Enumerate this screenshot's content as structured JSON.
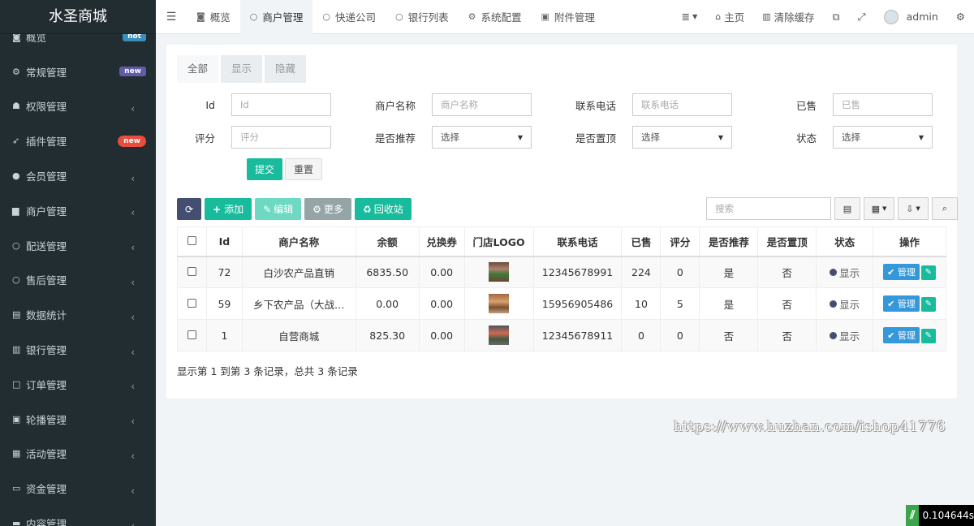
{
  "app_title": "水圣商城",
  "sidebar": {
    "items": [
      {
        "icon": "dashboard-icon",
        "glyph": "◙",
        "label": "概览",
        "badge": "hot",
        "badge_class": "hot"
      },
      {
        "icon": "cogs-icon",
        "glyph": "⚙",
        "label": "常规管理",
        "badge": "new",
        "badge_class": "new-purple"
      },
      {
        "icon": "group-icon",
        "glyph": "☗",
        "label": "权限管理",
        "chev": "‹"
      },
      {
        "icon": "rocket-icon",
        "glyph": "➶",
        "label": "插件管理",
        "badge": "new",
        "badge_class": "new-red"
      },
      {
        "icon": "user-circle-icon",
        "glyph": "●",
        "label": "会员管理",
        "chev": "‹"
      },
      {
        "icon": "shop-icon",
        "glyph": "▆",
        "label": "商户管理",
        "chev": "‹"
      },
      {
        "icon": "circle-outline-icon",
        "glyph": "○",
        "label": "配送管理",
        "chev": "‹"
      },
      {
        "icon": "circle-outline-icon",
        "glyph": "○",
        "label": "售后管理",
        "chev": "‹"
      },
      {
        "icon": "database-icon",
        "glyph": "▤",
        "label": "数据统计",
        "chev": "‹"
      },
      {
        "icon": "bank-icon",
        "glyph": "▥",
        "label": "银行管理",
        "chev": "‹"
      },
      {
        "icon": "order-icon",
        "glyph": "□",
        "label": "订单管理",
        "chev": "‹"
      },
      {
        "icon": "image-icon",
        "glyph": "▣",
        "label": "轮播管理",
        "chev": "‹"
      },
      {
        "icon": "gift-icon",
        "glyph": "▦",
        "label": "活动管理",
        "chev": "‹"
      },
      {
        "icon": "money-icon",
        "glyph": "▭",
        "label": "资金管理",
        "chev": "‹"
      },
      {
        "icon": "content-icon",
        "glyph": "▬",
        "label": "内容管理",
        "chev": "‹"
      }
    ]
  },
  "topbar": {
    "tabs": [
      {
        "icon": "dashboard-icon",
        "glyph": "◙",
        "label": "概览",
        "active": false
      },
      {
        "icon": "circle-outline-icon",
        "glyph": "○",
        "label": "商户管理",
        "active": true
      },
      {
        "icon": "circle-outline-icon",
        "glyph": "○",
        "label": "快递公司",
        "active": false
      },
      {
        "icon": "circle-outline-icon",
        "glyph": "○",
        "label": "银行列表",
        "active": false
      },
      {
        "icon": "gear-icon",
        "glyph": "⚙",
        "label": "系统配置",
        "active": false
      },
      {
        "icon": "file-image-icon",
        "glyph": "▣",
        "label": "附件管理",
        "active": false
      }
    ],
    "home_label": "主页",
    "clear_cache_label": "清除缓存",
    "user_label": "admin"
  },
  "filter_tabs": [
    "全部",
    "显示",
    "隐藏"
  ],
  "filters": {
    "id_label": "Id",
    "id_placeholder": "Id",
    "name_label": "商户名称",
    "name_placeholder": "商户名称",
    "phone_label": "联系电话",
    "phone_placeholder": "联系电话",
    "sold_label": "已售",
    "sold_placeholder": "已售",
    "score_label": "评分",
    "score_placeholder": "评分",
    "recommend_label": "是否推荐",
    "recommend_value": "选择",
    "top_label": "是否置顶",
    "top_value": "选择",
    "status_label": "状态",
    "status_value": "选择",
    "submit_label": "提交",
    "reset_label": "重置"
  },
  "toolbar": {
    "add_label": "添加",
    "edit_label": "编辑",
    "more_label": "更多",
    "recycle_label": "回收站",
    "search_placeholder": "搜索"
  },
  "table": {
    "headers": [
      "Id",
      "商户名称",
      "余额",
      "兑换券",
      "门店LOGO",
      "联系电话",
      "已售",
      "评分",
      "是否推荐",
      "是否置顶",
      "状态",
      "操作"
    ],
    "rows": [
      {
        "id": "72",
        "name": "白沙农产品直销",
        "balance": "6835.50",
        "coupon": "0.00",
        "phone": "12345678991",
        "sold": "224",
        "score": "0",
        "recommend": "是",
        "top": "否",
        "status": "显示"
      },
      {
        "id": "59",
        "name": "乡下农产品（大战…",
        "balance": "0.00",
        "coupon": "0.00",
        "phone": "15956905486",
        "sold": "10",
        "score": "5",
        "recommend": "是",
        "top": "否",
        "status": "显示"
      },
      {
        "id": "1",
        "name": "自营商城",
        "balance": "825.30",
        "coupon": "0.00",
        "phone": "12345678911",
        "sold": "0",
        "score": "0",
        "recommend": "否",
        "top": "否",
        "status": "显示"
      }
    ],
    "manage_label": "管理"
  },
  "pager_text": "显示第 1 到第 3 条记录，总共 3 条记录",
  "watermark": "https://www.huzhan.com/ishop41776",
  "timer": "0.104644s"
}
